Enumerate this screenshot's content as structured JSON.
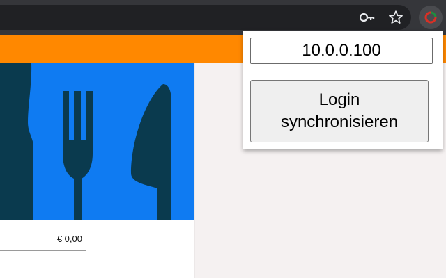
{
  "popup": {
    "ip_value": "10.0.0.100",
    "sync_button_label": "Login\nsynchronisieren"
  },
  "card": {
    "price": "€ 0,00"
  },
  "icons": {
    "password": "key-icon",
    "bookmark": "star-icon",
    "extension": "extension-icon",
    "card_image": "cutlery-icon"
  },
  "colors": {
    "toolbar": "#35363a",
    "accent_bar": "#ff8800",
    "card_image_bg": "#0f7bf2",
    "cutlery": "#0a3a4e"
  }
}
